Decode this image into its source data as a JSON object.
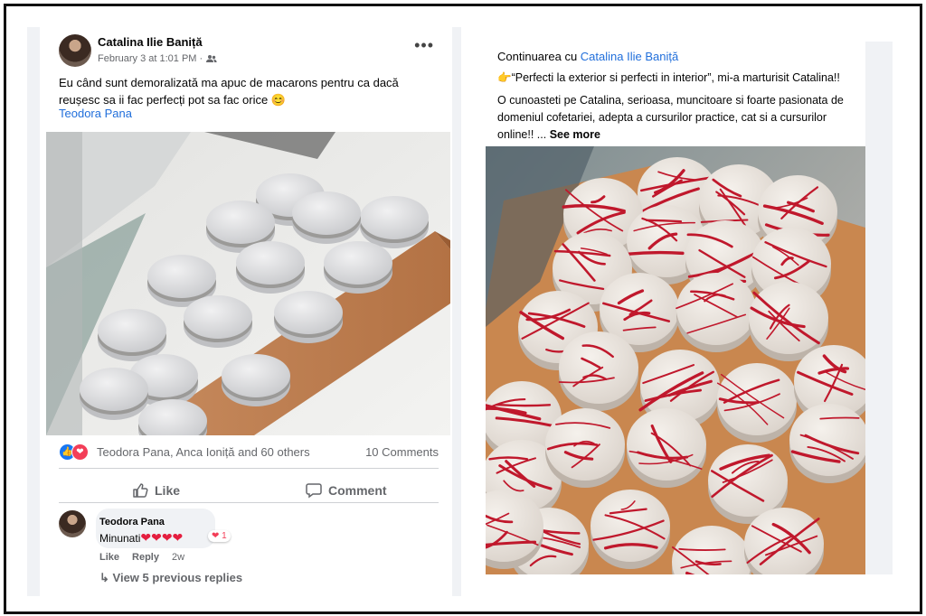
{
  "left_post": {
    "author": "Catalina Ilie Baniță",
    "meta": "February 3 at 1:01 PM ·",
    "text": "Eu când sunt demoralizată ma apuc de macarons pentru ca dacă reușesc sa ii fac perfecți pot sa fac orice 😊",
    "mention": "Teodora Pana",
    "reaction_names": "Teodora Pana, Anca Ioniță and 60 others",
    "comments_count": "10 Comments",
    "like_label": "Like",
    "comment_label": "Comment",
    "comment": {
      "author": "Teodora Pana",
      "text": "Minunati",
      "hearts": "❤❤❤❤",
      "reaction_count": "❤ 1",
      "like": "Like",
      "reply": "Reply",
      "age": "2w"
    },
    "view_replies": "View 5 previous replies"
  },
  "right_post": {
    "heading_prefix": "Continuarea cu ",
    "heading_link": "Catalina Ilie Baniță",
    "quote": "“Perfecti la exterior si perfecti in interior”, mi-a marturisit Catalina!!",
    "body": "O cunoasteti pe Catalina, serioasa, muncitoare si foarte pasionata de domeniul cofetariei, adepta a cursurilor practice, cat si a cursurilor online!! ...",
    "see_more": "See more"
  },
  "icons": [
    "more-options-icon",
    "friends-audience-icon",
    "like-reaction-icon",
    "love-reaction-icon",
    "thumbs-up-icon",
    "comment-icon",
    "reply-arrow-icon",
    "pointing-hand-icon"
  ],
  "colors": {
    "link": "#216fdb",
    "like_blue": "#1877f2",
    "love_red": "#f33e58",
    "drizzle": "#c0182c"
  }
}
